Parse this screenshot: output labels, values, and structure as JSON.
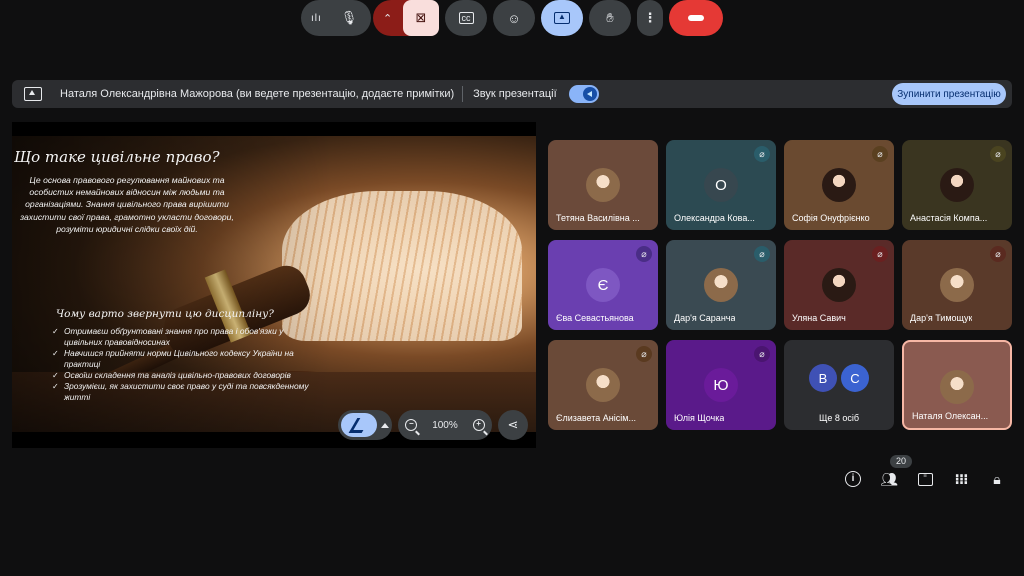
{
  "banner": {
    "status": "Наталя Олександрівна Мажорова (ви ведете презентацію, додаєте примітки)",
    "sound_label": "Звук презентації",
    "stop_label": "Зупинити презентацію"
  },
  "slide": {
    "heading": "Що таке цивільне право?",
    "intro": "Це основа правового регулювання майнових та особистих немайнових відносин між людьми та організаціями. Знання цивільного права вирішити захистити свої права, грамотно укласти договори, розуміти юридичні слідки своїх дій.",
    "subheading": "Чому варто звернути цю дисципліну?",
    "bullets": [
      "Отримаєш обґрунтовані знання про права і обов'язки у цивільних правовідносинах",
      "Навчишся прийняти норми Цивільного кодексу України на практиці",
      "Освоїш складення та аналіз цивільно-правових договорів",
      "Зрозумієш, як захистити своє право у суді та повсякденному житті"
    ]
  },
  "slide_tools": {
    "zoom": "100%"
  },
  "participants": [
    {
      "name": "Тетяна Василівна ...",
      "avatar": "photo-light",
      "bg": "#6b4a3a",
      "mute": ""
    },
    {
      "name": "Олександра Кова...",
      "avatar": "O",
      "avatar_bg": "#37474f",
      "bg": "#2c4a52",
      "mute": "#2a5d6a"
    },
    {
      "name": "Софія Онуфрієнко",
      "avatar": "photo",
      "bg": "#6a4a30",
      "mute": "#5a4020"
    },
    {
      "name": "Анастасія Компа...",
      "avatar": "photo",
      "bg": "#3a3520",
      "mute": "#4a4420"
    },
    {
      "name": "Єва Севастьянова",
      "avatar": "Є",
      "avatar_bg": "#7e57c2",
      "bg": "#6a3fb0",
      "mute": "#4a2d86"
    },
    {
      "name": "Дар'я Саранча",
      "avatar": "photo-light",
      "bg": "#3a4a52",
      "mute": "#2a5d6a"
    },
    {
      "name": "Уляна Савич",
      "avatar": "photo",
      "bg": "#5a2a28",
      "mute": "#6a2020"
    },
    {
      "name": "Дар'я Тимощук",
      "avatar": "photo-light",
      "bg": "#5a3a2a",
      "mute": "#5a2a20"
    },
    {
      "name": "Єлизавета Анісім...",
      "avatar": "photo-light",
      "bg": "#6a4a38",
      "mute": "#5a3a20"
    },
    {
      "name": "Юлія Щочка",
      "avatar": "Ю",
      "avatar_bg": "#6a1b9a",
      "bg": "#5a1a8a",
      "mute": "#4a1570"
    },
    {
      "name": "Ще 8 осіб",
      "more": [
        "В",
        "С"
      ],
      "bg": "#2c2d30"
    },
    {
      "name": "Наталя Олексан...",
      "avatar": "photo-light",
      "bg": "#8a5a50",
      "selected": true
    }
  ],
  "people_count": "20",
  "colors": {
    "accent": "#a8c7fa",
    "end_call": "#e53935",
    "camera_off": "#8c1d18"
  }
}
